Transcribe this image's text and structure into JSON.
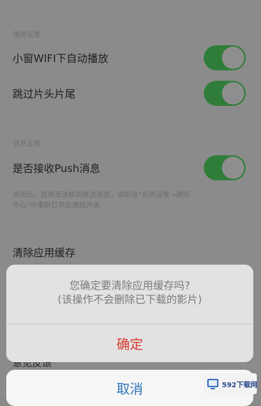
{
  "sections": {
    "playback": {
      "header": "播放设置",
      "rows": [
        {
          "label": "小窗WIFI下自动播放",
          "toggle_on": true
        },
        {
          "label": "跳过片头片尾",
          "toggle_on": true
        }
      ]
    },
    "message": {
      "header": "消息设置",
      "rows": [
        {
          "label": "是否接收Push消息",
          "toggle_on": true
        }
      ],
      "hint_lines": [
        "关闭后，您将无法收到推送消息，请前往“系统设置→通知",
        "中心”中重新打开此通知开关"
      ]
    },
    "clear_cache_label": "清除应用缓存",
    "under_sheet_label": "意见反馈"
  },
  "action_sheet": {
    "message_line1": "您确定要清除应用缓存吗?",
    "message_line2": "(该操作不会删除已下载的影片)",
    "confirm_label": "确定",
    "cancel_label": "取消"
  },
  "watermark": {
    "text": "592下载网"
  },
  "colors": {
    "toggle_on": "#2f7d39",
    "confirm": "#d93a2f",
    "cancel": "#2d74ba"
  }
}
